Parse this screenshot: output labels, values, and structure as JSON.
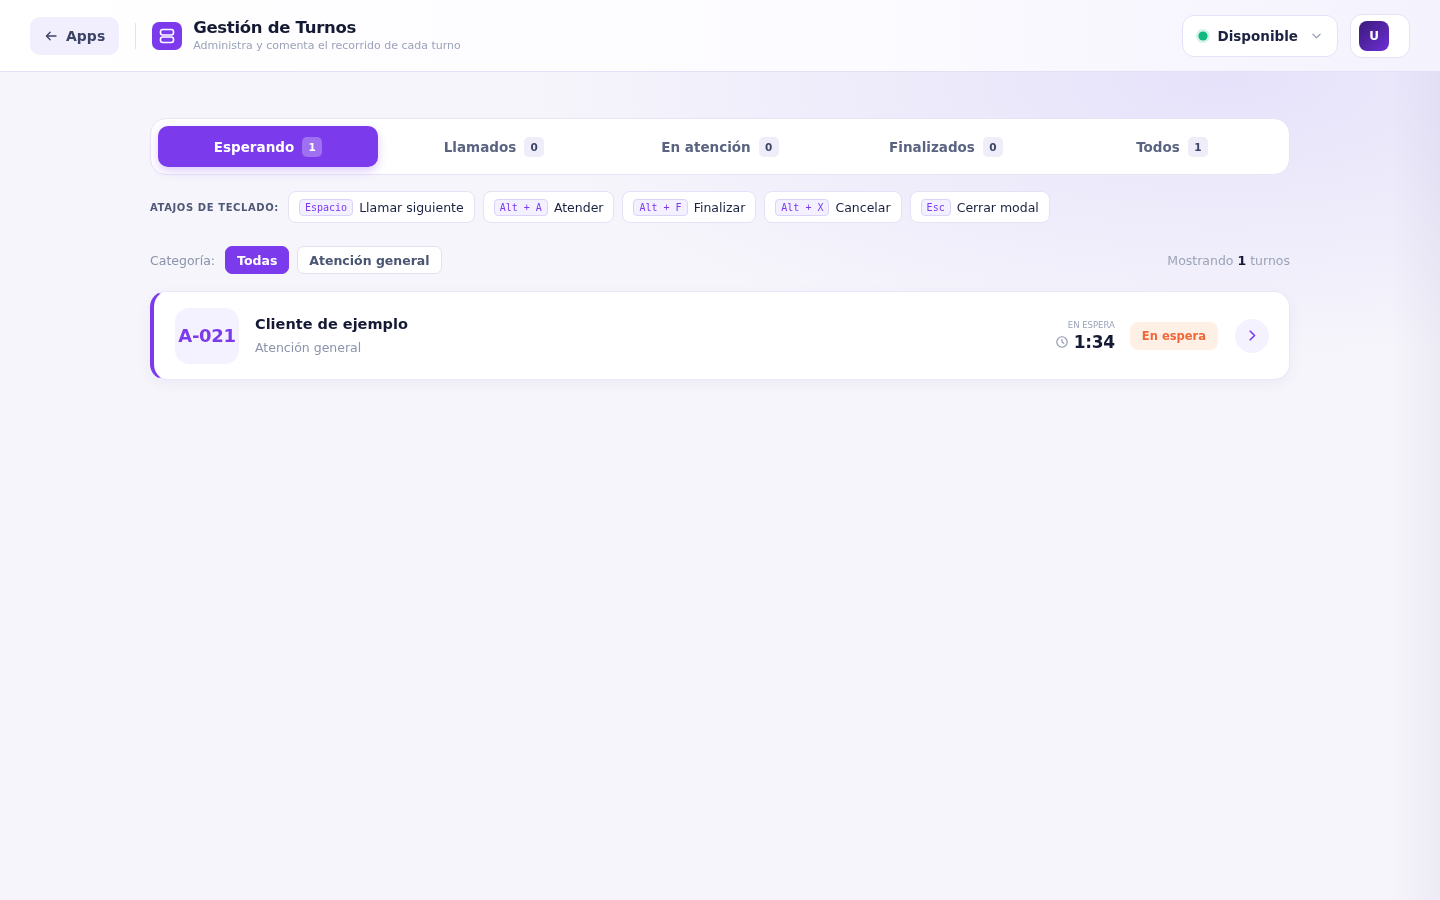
{
  "header": {
    "back_button": "Apps",
    "title": "Gestión de Turnos",
    "subtitle": "Administra y comenta el recorrido de cada turno",
    "status_menu": {
      "label": "Disponible",
      "online": true
    },
    "avatar": "U"
  },
  "tabs": [
    {
      "label": "Esperando",
      "count": "1",
      "selected": true
    },
    {
      "label": "Llamados",
      "count": "0",
      "selected": false
    },
    {
      "label": "En atención",
      "count": "0",
      "selected": false
    },
    {
      "label": "Finalizados",
      "count": "0",
      "selected": false
    },
    {
      "label": "Todos",
      "count": "1",
      "selected": false
    }
  ],
  "shortcuts": {
    "label": "ATAJOS DE TECLADO:",
    "items": [
      {
        "key": "Espacio",
        "action": "Llamar siguiente"
      },
      {
        "key": "Alt + A",
        "action": "Atender"
      },
      {
        "key": "Alt + F",
        "action": "Finalizar"
      },
      {
        "key": "Alt + X",
        "action": "Cancelar"
      },
      {
        "key": "Esc",
        "action": "Cerrar modal"
      }
    ]
  },
  "categories": {
    "label": "Categoría:",
    "items": [
      {
        "label": "Todas",
        "selected": true
      },
      {
        "label": "Atención general",
        "selected": false
      }
    ]
  },
  "summary": "Mostrando **1** turnos",
  "tickets": [
    {
      "code": "A-021",
      "name": "Cliente de ejemplo",
      "category": "Atención general",
      "timer_label": "EN ESPERA",
      "time": "1:34",
      "status": "En espera",
      "kind": "waiting"
    }
  ]
}
